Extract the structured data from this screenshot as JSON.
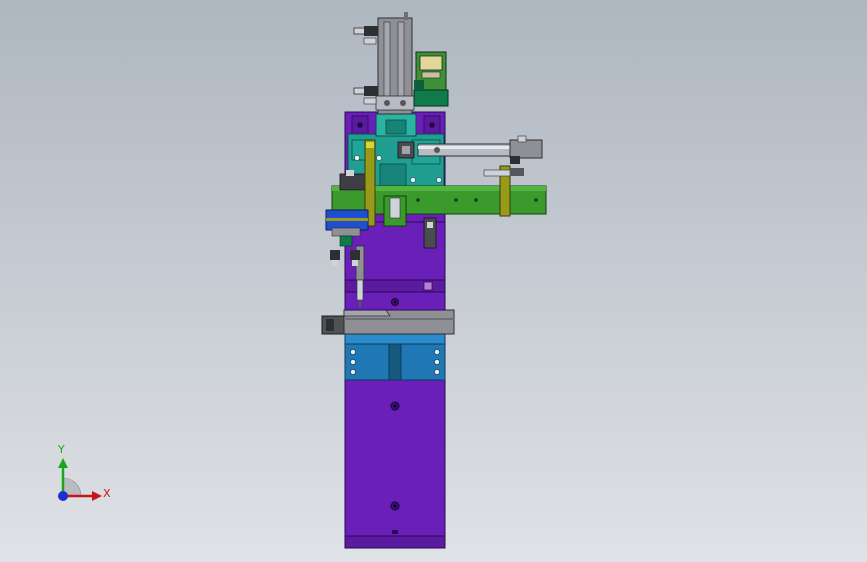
{
  "viewport": {
    "background_top": "#aeb6c0",
    "background_bottom": "#dfe2e6"
  },
  "model": {
    "colors": {
      "base_plate": "#6a1fb8",
      "cylinder_gray": "#8e9096",
      "slide_block": "#1f78b4",
      "teal_block": "#1f9e91",
      "green_arm": "#3a9a2c",
      "olive_bracket": "#9a9a1a",
      "dark_green": "#0f7a4a",
      "metal_steel": "#b7bcc4"
    }
  },
  "triad": {
    "x_label": "X",
    "y_label": "Y",
    "x_color": "#c8141e",
    "y_color": "#1aa51a",
    "z_color": "#1a2fd0"
  }
}
